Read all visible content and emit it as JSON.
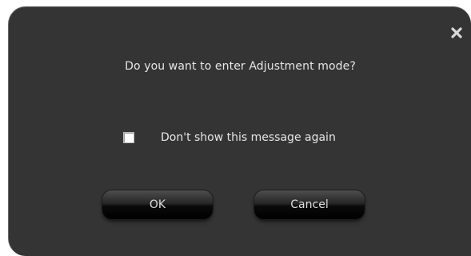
{
  "dialog": {
    "close_icon": "close-icon",
    "message": "Do you want to enter Adjustment mode?",
    "checkbox": {
      "label": "Don't show this message again",
      "checked": false
    },
    "buttons": {
      "ok_label": "OK",
      "cancel_label": "Cancel"
    }
  },
  "colors": {
    "dialog_background": "#343434",
    "text": "#e6e6e6"
  }
}
